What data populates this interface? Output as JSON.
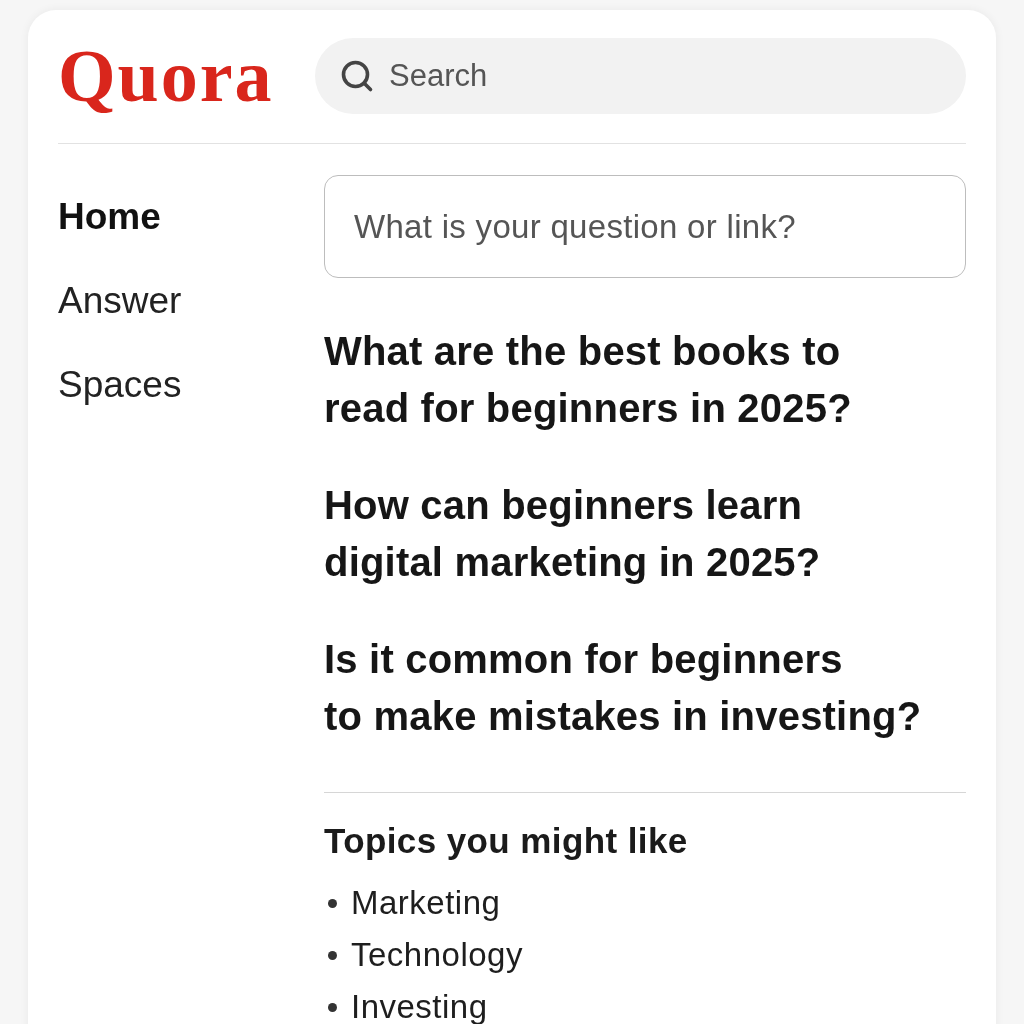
{
  "header": {
    "logo": "Quora",
    "search": {
      "placeholder": "Search"
    }
  },
  "sidebar": {
    "items": [
      {
        "label": "Home",
        "selected": true
      },
      {
        "label": "Answer",
        "selected": false
      },
      {
        "label": "Spaces",
        "selected": false
      }
    ]
  },
  "question_box": {
    "placeholder": "What is your question or link?"
  },
  "questions": [
    {
      "title": "What are the best books to\nread for beginners in 2025?"
    },
    {
      "title": "How can beginners learn\ndigital marketing in 2025?"
    },
    {
      "title": "Is it common for beginners\nto make mistakes in investing?"
    }
  ],
  "topics": {
    "title": "Topics you might like",
    "items": [
      "Marketing",
      "Technology",
      "Investing"
    ]
  }
}
